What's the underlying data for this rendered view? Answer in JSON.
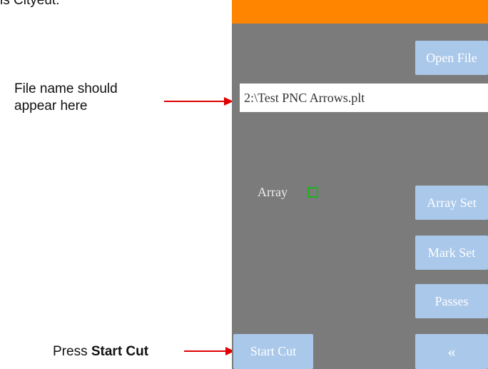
{
  "header_fragment": "is Cityeut.",
  "annotations": {
    "file_name_line1": "File name should",
    "file_name_line2": "appear here",
    "press_prefix": "Press ",
    "press_bold": "Start Cut"
  },
  "panel": {
    "open_file_label": "Open File",
    "file_name_value": "2:\\Test PNC Arrows.plt",
    "array_label": "Array",
    "array_checked": false,
    "buttons": {
      "array_set": "Array Set",
      "mark_set": "Mark Set",
      "passes": "Passes",
      "start_cut": "Start Cut",
      "back": "«"
    }
  },
  "colors": {
    "panel_bg": "#7b7b7b",
    "orange_bar": "#ff8400",
    "button_bg": "#aac8ea",
    "arrow": "#e00000",
    "checkbox_border": "#1db31d"
  }
}
